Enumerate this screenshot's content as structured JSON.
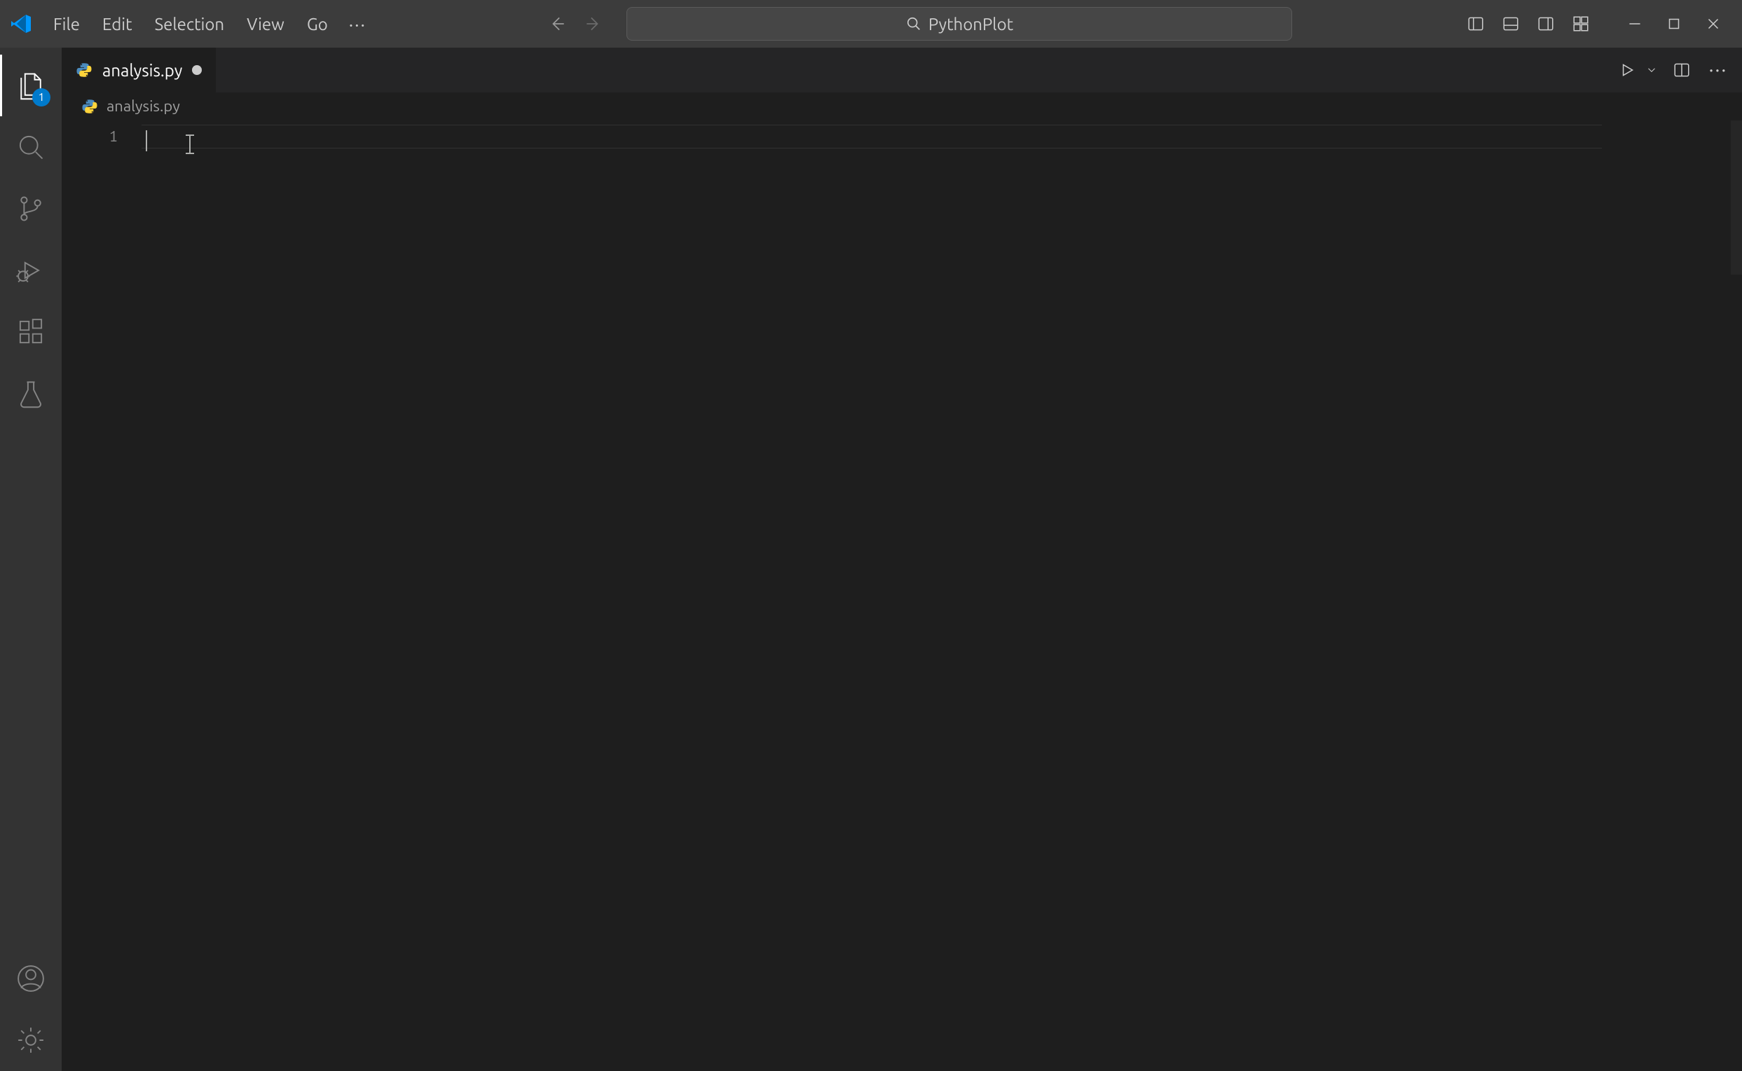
{
  "menu": {
    "items": [
      "File",
      "Edit",
      "Selection",
      "View",
      "Go"
    ],
    "overflow": "···"
  },
  "search": {
    "text": "PythonPlot"
  },
  "activity": {
    "explorer_badge": "1"
  },
  "tabs": [
    {
      "label": "analysis.py",
      "dirty": true
    }
  ],
  "breadcrumb": {
    "file": "analysis.py"
  },
  "editor": {
    "line_numbers": [
      "1"
    ],
    "lines": [
      ""
    ]
  }
}
